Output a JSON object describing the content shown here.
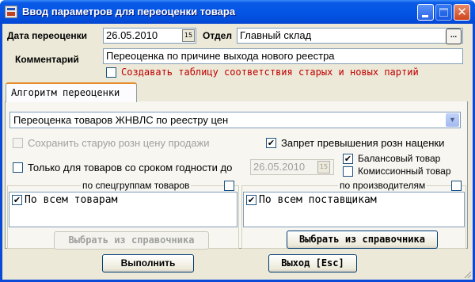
{
  "window": {
    "title": "Ввод параметров для переоценки товара"
  },
  "header": {
    "date_label": "Дата переоценки",
    "date_value": "26.05.2010",
    "dept_label": "Отдел",
    "dept_value": "Главный склад",
    "dept_button": "...",
    "comment_label": "Комментарий",
    "comment_value": "Переоценка по причине выхода нового реестра",
    "create_table_label": "Создавать таблицу соответствия старых и новых партий",
    "create_table_checked": false
  },
  "tabs": [
    {
      "label": "Алгоритм переоценки",
      "active": true
    }
  ],
  "algorithm": {
    "selected": "Переоценка товаров ЖНВЛС по реестру цен"
  },
  "options": {
    "keep_old_price_label": "Сохранить старую розн цену продажи",
    "keep_old_price_checked": false,
    "keep_old_price_enabled": false,
    "forbid_excess_label": "Запрет превышения розн наценки",
    "forbid_excess_checked": true,
    "expiry_only_label": "Только для товаров со сроком годности до",
    "expiry_only_checked": false,
    "expiry_date": "26.05.2010",
    "balance_goods_label": "Балансовый товар",
    "balance_goods_checked": true,
    "commission_goods_label": "Комиссионный товар",
    "commission_goods_checked": false
  },
  "groups_panel": {
    "title": "по спецгруппам товаров",
    "title_checked": false,
    "items": [
      {
        "label": "По всем товарам",
        "checked": true
      }
    ],
    "select_button": "Выбрать из справочника",
    "select_enabled": false
  },
  "producers_panel": {
    "title": "по производителям",
    "title_checked": false,
    "items": [
      {
        "label": "По всем поставщикам",
        "checked": true
      }
    ],
    "select_button": "Выбрать из справочника",
    "select_enabled": true
  },
  "footer": {
    "run_button": "Выполнить",
    "exit_button": "Выход [Esc]"
  },
  "glyphs": {
    "check": "✔",
    "calendar": "15",
    "minimize": "",
    "close": "✕",
    "dropdown": "▼"
  }
}
